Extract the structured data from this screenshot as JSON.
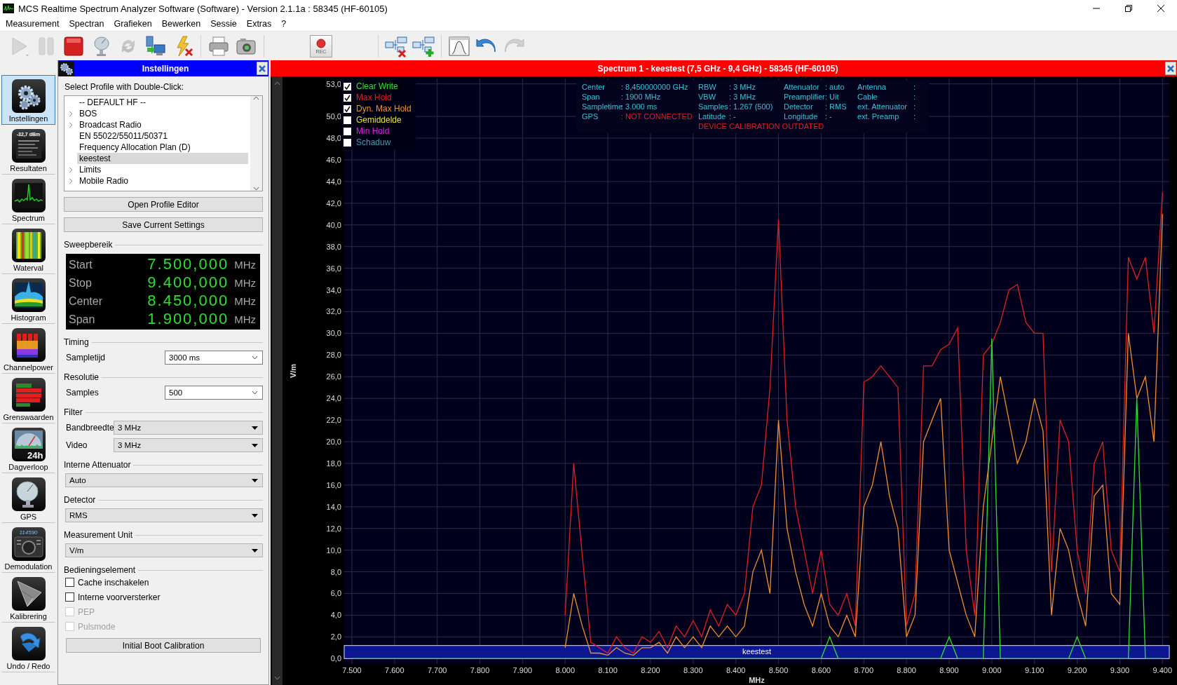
{
  "window": {
    "title": "MCS Realtime Spectrum Analyzer Software (Software) - Version 2.1.1a : 58345 (HF-60105)"
  },
  "menu": [
    "Measurement",
    "Spectran",
    "Grafieken",
    "Bewerken",
    "Sessie",
    "Extras",
    "?"
  ],
  "toolbar": [
    {
      "kind": "play",
      "disabled": true
    },
    {
      "kind": "pause",
      "disabled": true
    },
    {
      "kind": "stop",
      "disabled": false
    },
    {
      "kind": "dish",
      "disabled": false
    },
    {
      "kind": "refresh",
      "disabled": true
    },
    {
      "kind": "computer",
      "disabled": false
    },
    {
      "kind": "lightning",
      "disabled": false
    },
    {
      "kind": "separator"
    },
    {
      "kind": "printer",
      "disabled": false
    },
    {
      "kind": "camera",
      "disabled": false
    },
    {
      "kind": "separator"
    },
    {
      "kind": "gap"
    },
    {
      "kind": "record",
      "label": "REC",
      "disabled": false
    },
    {
      "kind": "gap"
    },
    {
      "kind": "separator"
    },
    {
      "kind": "window-remove",
      "disabled": false
    },
    {
      "kind": "window-add",
      "disabled": false
    },
    {
      "kind": "separator"
    },
    {
      "kind": "curve",
      "disabled": false
    },
    {
      "kind": "undo",
      "disabled": false
    },
    {
      "kind": "redo",
      "disabled": true
    }
  ],
  "nav": [
    {
      "label": "Instellingen",
      "kind": "settings",
      "selected": true
    },
    {
      "label": "Resultaten",
      "kind": "results",
      "icon_text": "-32,7 dBm",
      "selected": false
    },
    {
      "label": "Spectrum",
      "kind": "spectrum",
      "selected": false
    },
    {
      "label": "Waterval",
      "kind": "waterfall",
      "selected": false
    },
    {
      "label": "Histogram",
      "kind": "histogram",
      "selected": false
    },
    {
      "label": "Channelpower",
      "kind": "channelpower",
      "selected": false
    },
    {
      "label": "Grenswaarden",
      "kind": "limits",
      "selected": false
    },
    {
      "label": "Dagverloop",
      "kind": "daily",
      "icon_text": "24h",
      "selected": false
    },
    {
      "label": "GPS",
      "kind": "gps",
      "selected": false
    },
    {
      "label": "Demodulation",
      "kind": "demodulation",
      "icon_text": "114590",
      "selected": false
    },
    {
      "label": "Kalibrering",
      "kind": "calibration",
      "selected": false
    },
    {
      "label": "Undo / Redo",
      "kind": "undo",
      "selected": false
    }
  ],
  "settings": {
    "title": "Instellingen",
    "profile_label": "Select Profile with Double-Click:",
    "profiles": [
      {
        "label": "-- DEFAULT HF --",
        "kind": "item",
        "selected": false
      },
      {
        "label": "BOS",
        "kind": "group",
        "selected": false
      },
      {
        "label": "Broadcast Radio",
        "kind": "group",
        "selected": false
      },
      {
        "label": "EN 55022/55011/50371",
        "kind": "item",
        "selected": false
      },
      {
        "label": "Frequency Allocation Plan (D)",
        "kind": "item",
        "selected": false
      },
      {
        "label": "keestest",
        "kind": "item",
        "selected": true
      },
      {
        "label": "Limits",
        "kind": "group",
        "selected": false
      },
      {
        "label": "Mobile Radio",
        "kind": "group",
        "selected": false
      }
    ],
    "buttons": [
      "Open Profile Editor",
      "Save Current Settings"
    ],
    "sections": [
      {
        "kind": "readout",
        "title": "Sweepbereik",
        "rows": [
          {
            "label": "Start",
            "value": "7.500,000",
            "unit": "MHz"
          },
          {
            "label": "Stop",
            "value": "9.400,000",
            "unit": "MHz"
          },
          {
            "label": "Center",
            "value": "8.450,000",
            "unit": "MHz"
          },
          {
            "label": "Span",
            "value": "1.900,000",
            "unit": "MHz"
          }
        ]
      },
      {
        "kind": "fields",
        "title": "Timing",
        "fields": [
          {
            "kind": "combo",
            "label": "Sampletijd",
            "value": "3000 ms"
          }
        ]
      },
      {
        "kind": "fields",
        "title": "Resolutie",
        "fields": [
          {
            "kind": "combo",
            "label": "Samples",
            "value": "500"
          }
        ]
      },
      {
        "kind": "fields",
        "title": "Filter",
        "fields": [
          {
            "kind": "dropdown",
            "label": "Bandbreedte",
            "value": "3 MHz"
          },
          {
            "kind": "dropdown",
            "label": "Video",
            "value": "3 MHz"
          }
        ]
      },
      {
        "kind": "fields",
        "title": "Interne Attenuator",
        "fields": [
          {
            "kind": "dropdown",
            "value": "Auto"
          }
        ]
      },
      {
        "kind": "fields",
        "title": "Detector",
        "fields": [
          {
            "kind": "dropdown",
            "value": "RMS"
          }
        ]
      },
      {
        "kind": "fields",
        "title": "Measurement Unit",
        "fields": [
          {
            "kind": "dropdown",
            "value": "V/m"
          }
        ]
      },
      {
        "kind": "checks",
        "title": "Bedieningselement",
        "items": [
          {
            "label": "Cache inschakelen",
            "checked": false,
            "disabled": false
          },
          {
            "label": "Interne voorversterker",
            "checked": false,
            "disabled": false
          },
          {
            "label": "PEP",
            "checked": false,
            "disabled": true
          },
          {
            "label": "Pulsmode",
            "checked": false,
            "disabled": true
          }
        ]
      },
      {
        "kind": "button",
        "label": "Initial Boot Calibration"
      }
    ]
  },
  "spectrum": {
    "title": "Spectrum 1 - keestest (7,5 GHz - 9,4 GHz) - 58345 (HF-60105)",
    "traces": [
      {
        "kind": "series",
        "checked": true
      },
      {
        "kind": "series",
        "checked": true
      },
      {
        "kind": "series",
        "checked": true
      },
      {
        "kind": "trace",
        "label": "Gemiddelde",
        "checked": false,
        "color": "#e8e040"
      },
      {
        "kind": "trace",
        "label": "Min Hold",
        "checked": false,
        "color": "#e020e0"
      },
      {
        "kind": "trace",
        "label": "Schaduw",
        "checked": false,
        "color": "#4a9aa8"
      }
    ],
    "info": [
      {
        "label": "Center",
        "value": ": 8,450000000 GHz",
        "alert": false
      },
      {
        "label": "RBW",
        "value": ": 3 MHz",
        "alert": false
      },
      {
        "label": "Attenuator",
        "value": ": auto",
        "alert": false
      },
      {
        "label": "Antenna",
        "value": ":",
        "alert": false
      },
      {
        "label": "Span",
        "value": ": 1900 MHz",
        "alert": false
      },
      {
        "label": "VBW",
        "value": ": 3 MHz",
        "alert": false
      },
      {
        "label": "Preamplifier",
        "value": ": Uit",
        "alert": false
      },
      {
        "label": "Cable",
        "value": ":",
        "alert": false
      },
      {
        "label": "Sampletime",
        "value": ": 3.000 ms",
        "alert": false
      },
      {
        "label": "Samples",
        "value": ": 1.267 (500)",
        "alert": false
      },
      {
        "label": "Detector",
        "value": ": RMS",
        "alert": false
      },
      {
        "label": "ext. Attenuator",
        "value": ":",
        "alert": false
      },
      {
        "label": "GPS",
        "value": ": NOT CONNECTED",
        "alert": true
      },
      {
        "label": "Latitude",
        "value": ": -",
        "alert": false
      },
      {
        "label": "Longitude",
        "value": ": -",
        "alert": false
      },
      {
        "label": "ext. Preamp",
        "value": ":",
        "alert": false
      }
    ],
    "warning": "DEVICE CALIBRATION OUTDATED",
    "chart_data": {
      "type": "line",
      "grid": true,
      "xlabel": "MHz",
      "ylabel": "V/m",
      "xlim": [
        7482,
        9416
      ],
      "ylim": [
        -0.5,
        53.5
      ],
      "xticks": [
        {
          "value": 7500,
          "label": "7.500"
        },
        {
          "value": 7600,
          "label": "7.600"
        },
        {
          "value": 7700,
          "label": "7.700"
        },
        {
          "value": 7800,
          "label": "7.800"
        },
        {
          "value": 7900,
          "label": "7.900"
        },
        {
          "value": 8000,
          "label": "8.000"
        },
        {
          "value": 8100,
          "label": "8.100"
        },
        {
          "value": 8200,
          "label": "8.200"
        },
        {
          "value": 8300,
          "label": "8.300"
        },
        {
          "value": 8400,
          "label": "8.400"
        },
        {
          "value": 8500,
          "label": "8.500"
        },
        {
          "value": 8600,
          "label": "8.600"
        },
        {
          "value": 8700,
          "label": "8.700"
        },
        {
          "value": 8800,
          "label": "8.800"
        },
        {
          "value": 8900,
          "label": "8.900"
        },
        {
          "value": 9000,
          "label": "9.000"
        },
        {
          "value": 9100,
          "label": "9.100"
        },
        {
          "value": 9200,
          "label": "9.200"
        },
        {
          "value": 9300,
          "label": "9.300"
        },
        {
          "value": 9400,
          "label": "9.400"
        }
      ],
      "yticks": [
        {
          "value": 0,
          "label": "0,0"
        },
        {
          "value": 2,
          "label": "2,0"
        },
        {
          "value": 4,
          "label": "4,0"
        },
        {
          "value": 6,
          "label": "6,0"
        },
        {
          "value": 8,
          "label": "8,0"
        },
        {
          "value": 10,
          "label": "10,0"
        },
        {
          "value": 12,
          "label": "12,0"
        },
        {
          "value": 14,
          "label": "14,0"
        },
        {
          "value": 16,
          "label": "16,0"
        },
        {
          "value": 18,
          "label": "18,0"
        },
        {
          "value": 20,
          "label": "20,0"
        },
        {
          "value": 22,
          "label": "22,0"
        },
        {
          "value": 24,
          "label": "24,0"
        },
        {
          "value": 26,
          "label": "26,0"
        },
        {
          "value": 28,
          "label": "28,0"
        },
        {
          "value": 30,
          "label": "30,0"
        },
        {
          "value": 32,
          "label": "32,0"
        },
        {
          "value": 34,
          "label": "34,0"
        },
        {
          "value": 36,
          "label": "36,0"
        },
        {
          "value": 38,
          "label": "38,0"
        },
        {
          "value": 40,
          "label": "40,0"
        },
        {
          "value": 42,
          "label": "42,0"
        },
        {
          "value": 44,
          "label": "44,0"
        },
        {
          "value": 46,
          "label": "46,0"
        },
        {
          "value": 48,
          "label": "48,0"
        },
        {
          "value": 50,
          "label": "50,0"
        },
        {
          "value": 53,
          "label": "53,0"
        }
      ],
      "x": [
        7500,
        7520,
        7540,
        7560,
        7580,
        7600,
        7620,
        7640,
        7660,
        7680,
        7700,
        7720,
        7740,
        7760,
        7780,
        7800,
        7820,
        7840,
        7860,
        7880,
        7900,
        7920,
        7940,
        7960,
        7980,
        8000,
        8020,
        8040,
        8060,
        8080,
        8100,
        8120,
        8140,
        8160,
        8180,
        8200,
        8220,
        8240,
        8260,
        8280,
        8300,
        8320,
        8340,
        8360,
        8380,
        8400,
        8420,
        8440,
        8460,
        8480,
        8500,
        8520,
        8540,
        8560,
        8580,
        8600,
        8620,
        8640,
        8660,
        8680,
        8700,
        8720,
        8740,
        8760,
        8780,
        8800,
        8820,
        8840,
        8860,
        8880,
        8900,
        8920,
        8940,
        8960,
        8980,
        9000,
        9020,
        9040,
        9060,
        9080,
        9100,
        9120,
        9140,
        9160,
        9180,
        9200,
        9220,
        9240,
        9260,
        9280,
        9300,
        9320,
        9340,
        9360,
        9380,
        9400
      ],
      "series": [
        {
          "name": "Clear Write",
          "color": "#30e030",
          "values": [
            0,
            0,
            0,
            0,
            0,
            0,
            0,
            0,
            0,
            0,
            0,
            0,
            0,
            0,
            0,
            0,
            0,
            0,
            0,
            0,
            0,
            0,
            0,
            0,
            0,
            0,
            0,
            0,
            0,
            0,
            0,
            0,
            0,
            0,
            0,
            0,
            0,
            0,
            0,
            0,
            0,
            0,
            0,
            0,
            0,
            0,
            0,
            0,
            0,
            0,
            0,
            0,
            0,
            0,
            0,
            0,
            2,
            0,
            0,
            0,
            0,
            0,
            0,
            0,
            0,
            0,
            0,
            0,
            0,
            0,
            2,
            0,
            0,
            0,
            0,
            29.5,
            0,
            0,
            0,
            0,
            0,
            0,
            0,
            0,
            0,
            2,
            0,
            0,
            0,
            0,
            0,
            0,
            24,
            0,
            0,
            0
          ]
        },
        {
          "name": "Max Hold",
          "color": "#e02020",
          "values": [
            null,
            null,
            null,
            null,
            null,
            null,
            null,
            null,
            null,
            null,
            null,
            null,
            null,
            null,
            null,
            null,
            null,
            null,
            null,
            null,
            null,
            null,
            null,
            null,
            null,
            4,
            18,
            9.5,
            1.5,
            1,
            0.5,
            2,
            1,
            0.5,
            2,
            1.5,
            2.5,
            1,
            3,
            2,
            3.5,
            2,
            4.5,
            3,
            5,
            4,
            6,
            14,
            16,
            25,
            40.5,
            22,
            14,
            10,
            6,
            10,
            5,
            4,
            6,
            3,
            25.5,
            26,
            27,
            26,
            25,
            3,
            6,
            27,
            27,
            28.5,
            29,
            30.5,
            10,
            4,
            28,
            29,
            31,
            34,
            34.5,
            31,
            30,
            30,
            8,
            22,
            20,
            10,
            6,
            18,
            20,
            10,
            8,
            37,
            35,
            37,
            30,
            43
          ]
        },
        {
          "name": "Dyn. Max Hold",
          "color": "#f09030",
          "values": [
            null,
            null,
            null,
            null,
            null,
            null,
            null,
            null,
            null,
            null,
            null,
            null,
            null,
            null,
            null,
            null,
            null,
            null,
            null,
            null,
            null,
            null,
            null,
            null,
            null,
            1,
            6,
            3,
            0.5,
            0.5,
            0.3,
            1,
            0.5,
            0.3,
            1,
            1,
            1.5,
            0.5,
            2,
            1,
            2,
            1,
            3,
            2,
            3,
            2,
            3,
            8,
            10,
            6,
            22,
            12,
            8,
            5,
            3,
            6,
            3,
            2,
            4,
            2,
            14,
            16,
            20,
            15,
            12,
            2,
            4,
            20,
            22,
            24,
            10,
            7,
            4,
            2,
            14,
            20,
            26,
            22,
            18,
            20,
            24,
            21,
            4,
            12,
            10,
            6,
            3,
            15,
            16,
            6,
            5,
            30,
            24,
            26,
            20,
            41
          ]
        }
      ],
      "bands": [
        {
          "axis": "y",
          "from": 0,
          "to": 1.2,
          "label": "keestest",
          "color": "#0c1690"
        }
      ]
    }
  }
}
